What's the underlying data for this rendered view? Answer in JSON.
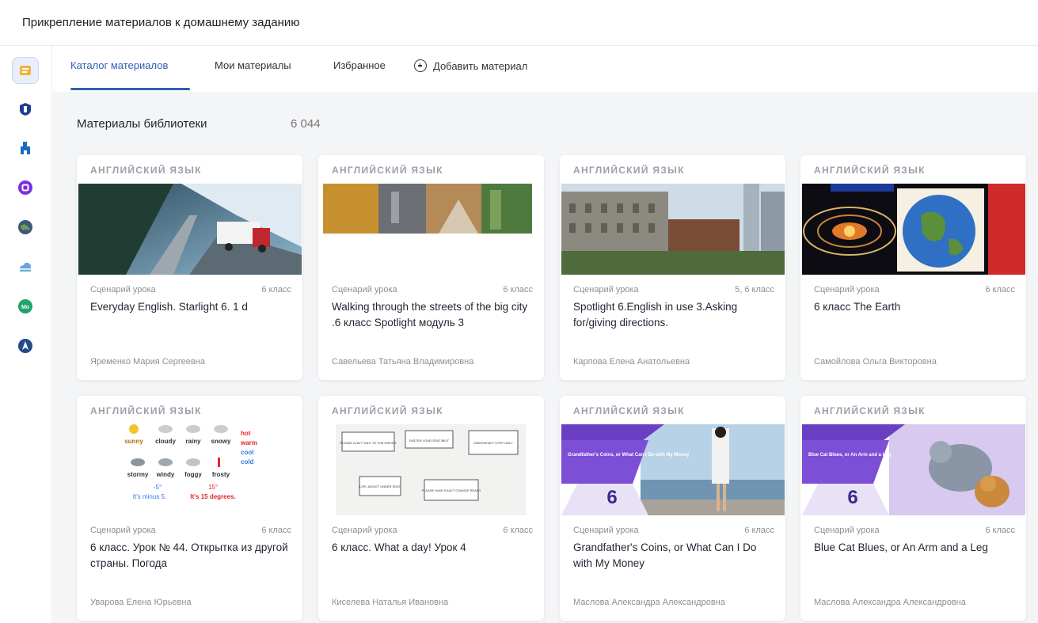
{
  "header": {
    "title": "Прикрепление материалов к домашнему заданию"
  },
  "sidebar": {
    "items": [
      {
        "icon": "library-icon",
        "color": "#f2b33d",
        "active": true
      },
      {
        "icon": "blue-shield-icon",
        "color": "#1d3f8f"
      },
      {
        "icon": "blue-figure-icon",
        "color": "#1a6ec0"
      },
      {
        "icon": "purple-app-icon",
        "color": "#7a2ee0"
      },
      {
        "icon": "globe-icon",
        "color": "#3b5878"
      },
      {
        "icon": "cloud-icon",
        "color": "#6aa7d8"
      },
      {
        "icon": "mo-icon",
        "color": "#22a36b"
      },
      {
        "icon": "compass-icon",
        "color": "#244a8a"
      }
    ]
  },
  "tabs": [
    {
      "label": "Каталог материалов",
      "active": true
    },
    {
      "label": "Мои материалы"
    },
    {
      "label": "Избранное"
    },
    {
      "label": "Добавить материал"
    }
  ],
  "library": {
    "title": "Материалы библиотеки",
    "count": "6 044"
  },
  "cards": [
    {
      "subject": "Английский язык",
      "type": "Сценарий урока",
      "grade": "6 класс",
      "title": "Everyday English. Starlight 6. 1 d",
      "author": "Яременко Мария Сергеевна"
    },
    {
      "subject": "Английский язык",
      "type": "Сценарий урока",
      "grade": "6 класс",
      "title": "Walking through the streets of the big city .6 класс Spotlight модуль 3",
      "author": "Савельева Татьяна Владимировна"
    },
    {
      "subject": "Английский язык",
      "type": "Сценарий урока",
      "grade": "5, 6 класс",
      "title": "Spotlight 6.English in use 3.Asking for/giving directions.",
      "author": "Карпова Елена Анатольевна"
    },
    {
      "subject": "Английский язык",
      "type": "Сценарий урока",
      "grade": "6 класс",
      "title": "6 класс The Earth",
      "author": "Самойлова Ольга Викторовна"
    },
    {
      "subject": "Английский язык",
      "type": "Сценарий урока",
      "grade": "6 класс",
      "title": "6 класс. Урок № 44. Открытка из другой страны. Погода",
      "author": "Уварова Елена Юрьевна"
    },
    {
      "subject": "Английский язык",
      "type": "Сценарий урока",
      "grade": "6 класс",
      "title": "6 класс. What a day! Урок 4",
      "author": "Киселева Наталья Ивановна"
    },
    {
      "subject": "Английский язык",
      "type": "Сценарий урока",
      "grade": "6 класс",
      "title": "Grandfather's Coins, or What Can I Do with My Money",
      "author": "Маслова Александра Александровна"
    },
    {
      "subject": "Английский язык",
      "type": "Сценарий урока",
      "grade": "6 класс",
      "title": "Blue Cat Blues, or An Arm and a Leg",
      "author": "Маслова Александра Александровна"
    }
  ],
  "thumbs": {
    "weather": {
      "row1": [
        "sunny",
        "cloudy",
        "rainy",
        "snowy"
      ],
      "row2": [
        "stormy",
        "windy",
        "foggy",
        "frosty"
      ],
      "side": [
        "hot",
        "warm",
        "cool",
        "cold"
      ],
      "temps": [
        "-5°",
        "15°"
      ],
      "captions": [
        "It's minus 5.",
        "It's 15 degrees."
      ]
    },
    "signs": [
      "PLEASE DON'T TALK TO THE DRIVER",
      "FASTEN YOUR SEAT BELT",
      "EMERGENCY STOP ONLY",
      "LIFE JACKET UNDER SEAT",
      "PLEASE HAVE EXACT CHANGE READY"
    ],
    "unit": "6"
  }
}
